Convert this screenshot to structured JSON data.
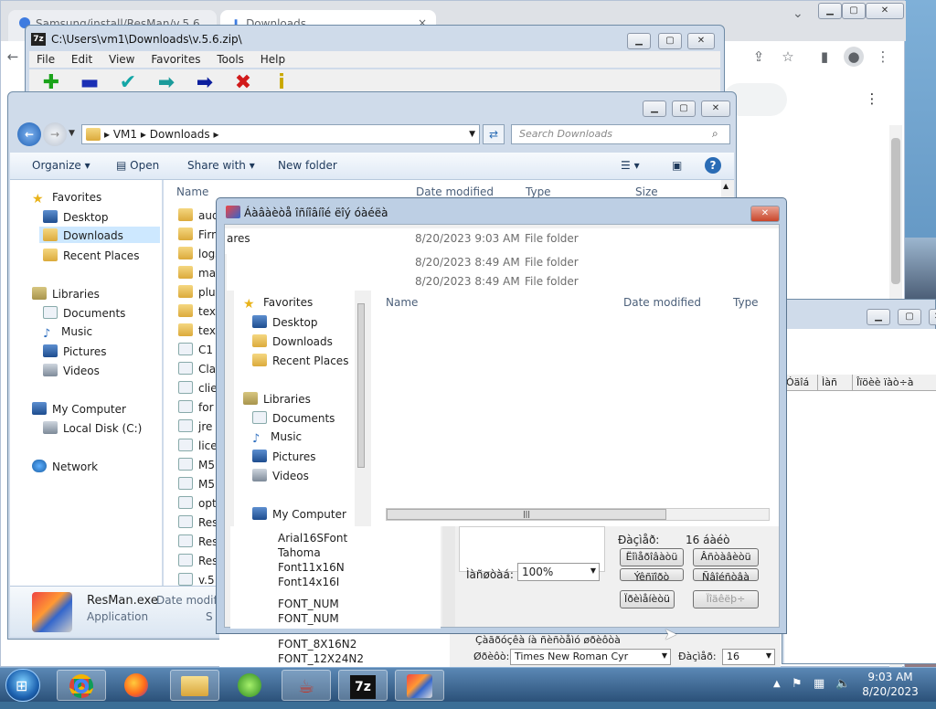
{
  "chrome": {
    "tab1": "Samsung/install/ResMan/v.5.6",
    "tab2": "Downloads",
    "tab_close": "×"
  },
  "sevenzip": {
    "title": "C:\\Users\\vm1\\Downloads\\v.5.6.zip\\",
    "menu": [
      "File",
      "Edit",
      "View",
      "Favorites",
      "Tools",
      "Help"
    ],
    "toolbar": [
      {
        "glyph": "✚",
        "color": "#1aa31a",
        "icon": "add-icon"
      },
      {
        "glyph": "▬",
        "color": "#1a2fb5",
        "icon": "extract-icon"
      },
      {
        "glyph": "✔",
        "color": "#13a6a6",
        "icon": "test-icon"
      },
      {
        "glyph": "➡",
        "color": "#1a9b9b",
        "icon": "copy-icon"
      },
      {
        "glyph": "➡",
        "color": "#0d1f9e",
        "icon": "move-icon"
      },
      {
        "glyph": "✖",
        "color": "#d11a1a",
        "icon": "delete-icon"
      },
      {
        "glyph": "i",
        "color": "#c9a800",
        "icon": "info-icon"
      }
    ]
  },
  "explorer": {
    "breadcrumb": [
      "VM1",
      "Downloads"
    ],
    "search_placeholder": "Search Downloads",
    "commands": [
      "Organize",
      "Open",
      "Share with",
      "New folder"
    ],
    "nav": {
      "favorites": "Favorites",
      "fav_items": [
        "Desktop",
        "Downloads",
        "Recent Places"
      ],
      "libraries": "Libraries",
      "lib_items": [
        "Documents",
        "Music",
        "Pictures",
        "Videos"
      ],
      "computer": "My Computer",
      "comp_items": [
        "Local Disk (C:)"
      ],
      "network": "Network"
    },
    "columns": [
      "Name",
      "Date modified",
      "Type",
      "Size"
    ],
    "files": [
      "audi",
      "Firmwares",
      "logs",
      "map",
      "plug",
      "tex",
      "tex",
      "C1",
      "Cla",
      "clie",
      "for",
      "jre",
      "lice",
      "M5",
      "M5",
      "opt",
      "Res",
      "Res",
      "Res",
      "v.5"
    ],
    "file_rows": [
      {
        "date": "8/20/2023 9:03 AM",
        "type": "File folder"
      },
      {
        "date": "8/20/2023 8:49 AM",
        "type": "File folder"
      },
      {
        "date": "8/20/2023 8:49 AM",
        "type": "File folder"
      }
    ],
    "details_name": "ResMan.exe",
    "details_type": "Application",
    "details_date_label": "Date modif",
    "details_extra": "S"
  },
  "dialog": {
    "title": "Áàâàèòå îñíîâíîé ëîý óàéëà",
    "ghost_name": "ares",
    "nav_favorites": "Favorites",
    "nav_fav_items": [
      "Desktop",
      "Downloads",
      "Recent Places"
    ],
    "nav_libraries": "Libraries",
    "nav_lib_items": [
      "Documents",
      "Music",
      "Pictures",
      "Videos"
    ],
    "nav_computer": "My Computer",
    "columns": [
      "Name",
      "Date modified",
      "Type"
    ],
    "fonts": [
      "Arial16SFont",
      "Tahoma",
      "Font11x16N",
      "Font14x16I",
      "FONT_NUM",
      "FONT_NUM",
      "FONT_8X16N2",
      "FONT_12X24N2"
    ],
    "size_label": "Ðàçìåð:",
    "size_value": "16 áàéò",
    "zoom_label": "Ìàñøòàá:",
    "zoom_value": "100%",
    "btn1": "Ëîìåðîâàòü",
    "btn2": "Âñòàâèòü",
    "btn3": "Ýêñïîðò",
    "btn4": "Ñâîéñòâà",
    "btn5": "Ïðèìåíèòü",
    "btn6": "Ïîäêëþ÷",
    "font_hint": "Çàãðóçêà íà ñèñòåìó øðèôòà",
    "font_label": "Øðèôò:",
    "font_value": "Times New Roman Cyr",
    "fsize_label": "Ðàçìåð:",
    "fsize_value": "16"
  },
  "rightwin": {
    "cols": [
      "Óäîá",
      "Ìàñ",
      "Îïöèè ïàò÷à"
    ]
  },
  "taskbar": {
    "time": "9:03 AM",
    "date": "8/20/2023"
  }
}
